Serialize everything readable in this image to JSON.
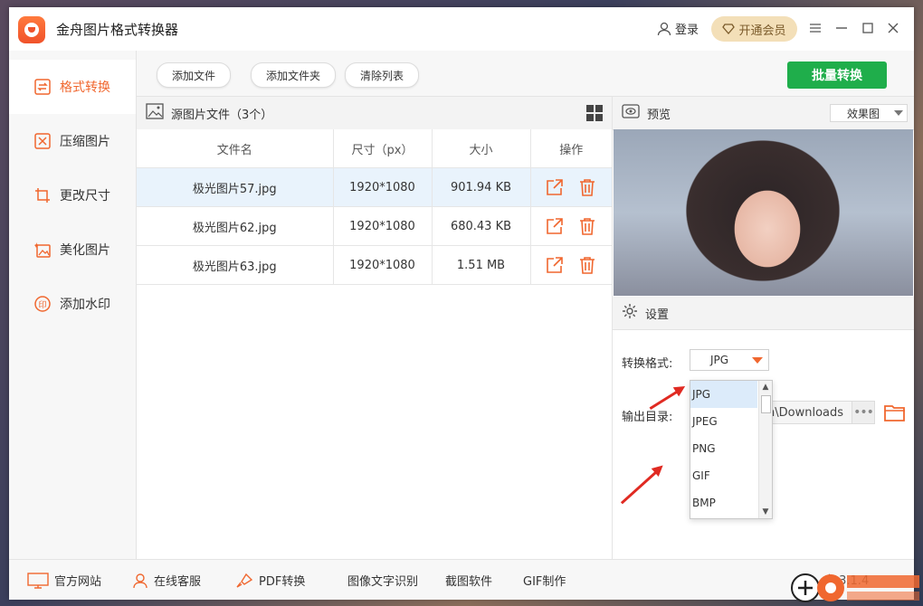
{
  "app": {
    "title": "金舟图片格式转换器",
    "login_label": "登录",
    "vip_label": "开通会员"
  },
  "sidebar": {
    "items": [
      {
        "label": "格式转换",
        "icon": "swap-icon",
        "active": true
      },
      {
        "label": "压缩图片",
        "icon": "compress-icon",
        "active": false
      },
      {
        "label": "更改尺寸",
        "icon": "crop-icon",
        "active": false
      },
      {
        "label": "美化图片",
        "icon": "beautify-icon",
        "active": false
      },
      {
        "label": "添加水印",
        "icon": "stamp-icon",
        "active": false
      }
    ]
  },
  "toolbar": {
    "add_file": "添加文件",
    "add_folder": "添加文件夹",
    "clear_list": "清除列表",
    "batch_convert": "批量转换"
  },
  "files": {
    "header": "源图片文件（3个）",
    "columns": [
      "文件名",
      "尺寸（px）",
      "大小",
      "操作"
    ],
    "rows": [
      {
        "name": "极光图片57.jpg",
        "size_px": "1920*1080",
        "size": "901.94 KB",
        "selected": true
      },
      {
        "name": "极光图片62.jpg",
        "size_px": "1920*1080",
        "size": "680.43 KB",
        "selected": false
      },
      {
        "name": "极光图片63.jpg",
        "size_px": "1920*1080",
        "size": "1.51 MB",
        "selected": false
      }
    ]
  },
  "preview": {
    "header": "预览",
    "mode": "效果图"
  },
  "settings": {
    "header": "设置",
    "format_label": "转换格式:",
    "format_value": "JPG",
    "output_label": "输出目录:",
    "output_path": "n\\Downloads",
    "format_options": [
      "JPG",
      "JPEG",
      "PNG",
      "GIF",
      "BMP"
    ]
  },
  "bottom": {
    "website": "官方网站",
    "service": "在线客服",
    "pdf": "PDF转换",
    "ocr": "图像文字识别",
    "screenshot": "截图软件",
    "gif": "GIF制作",
    "version": "本 3.1.4"
  },
  "colors": {
    "accent": "#f0672f",
    "batch_green": "#1fae4b",
    "selected_row": "#e9f3fc"
  }
}
